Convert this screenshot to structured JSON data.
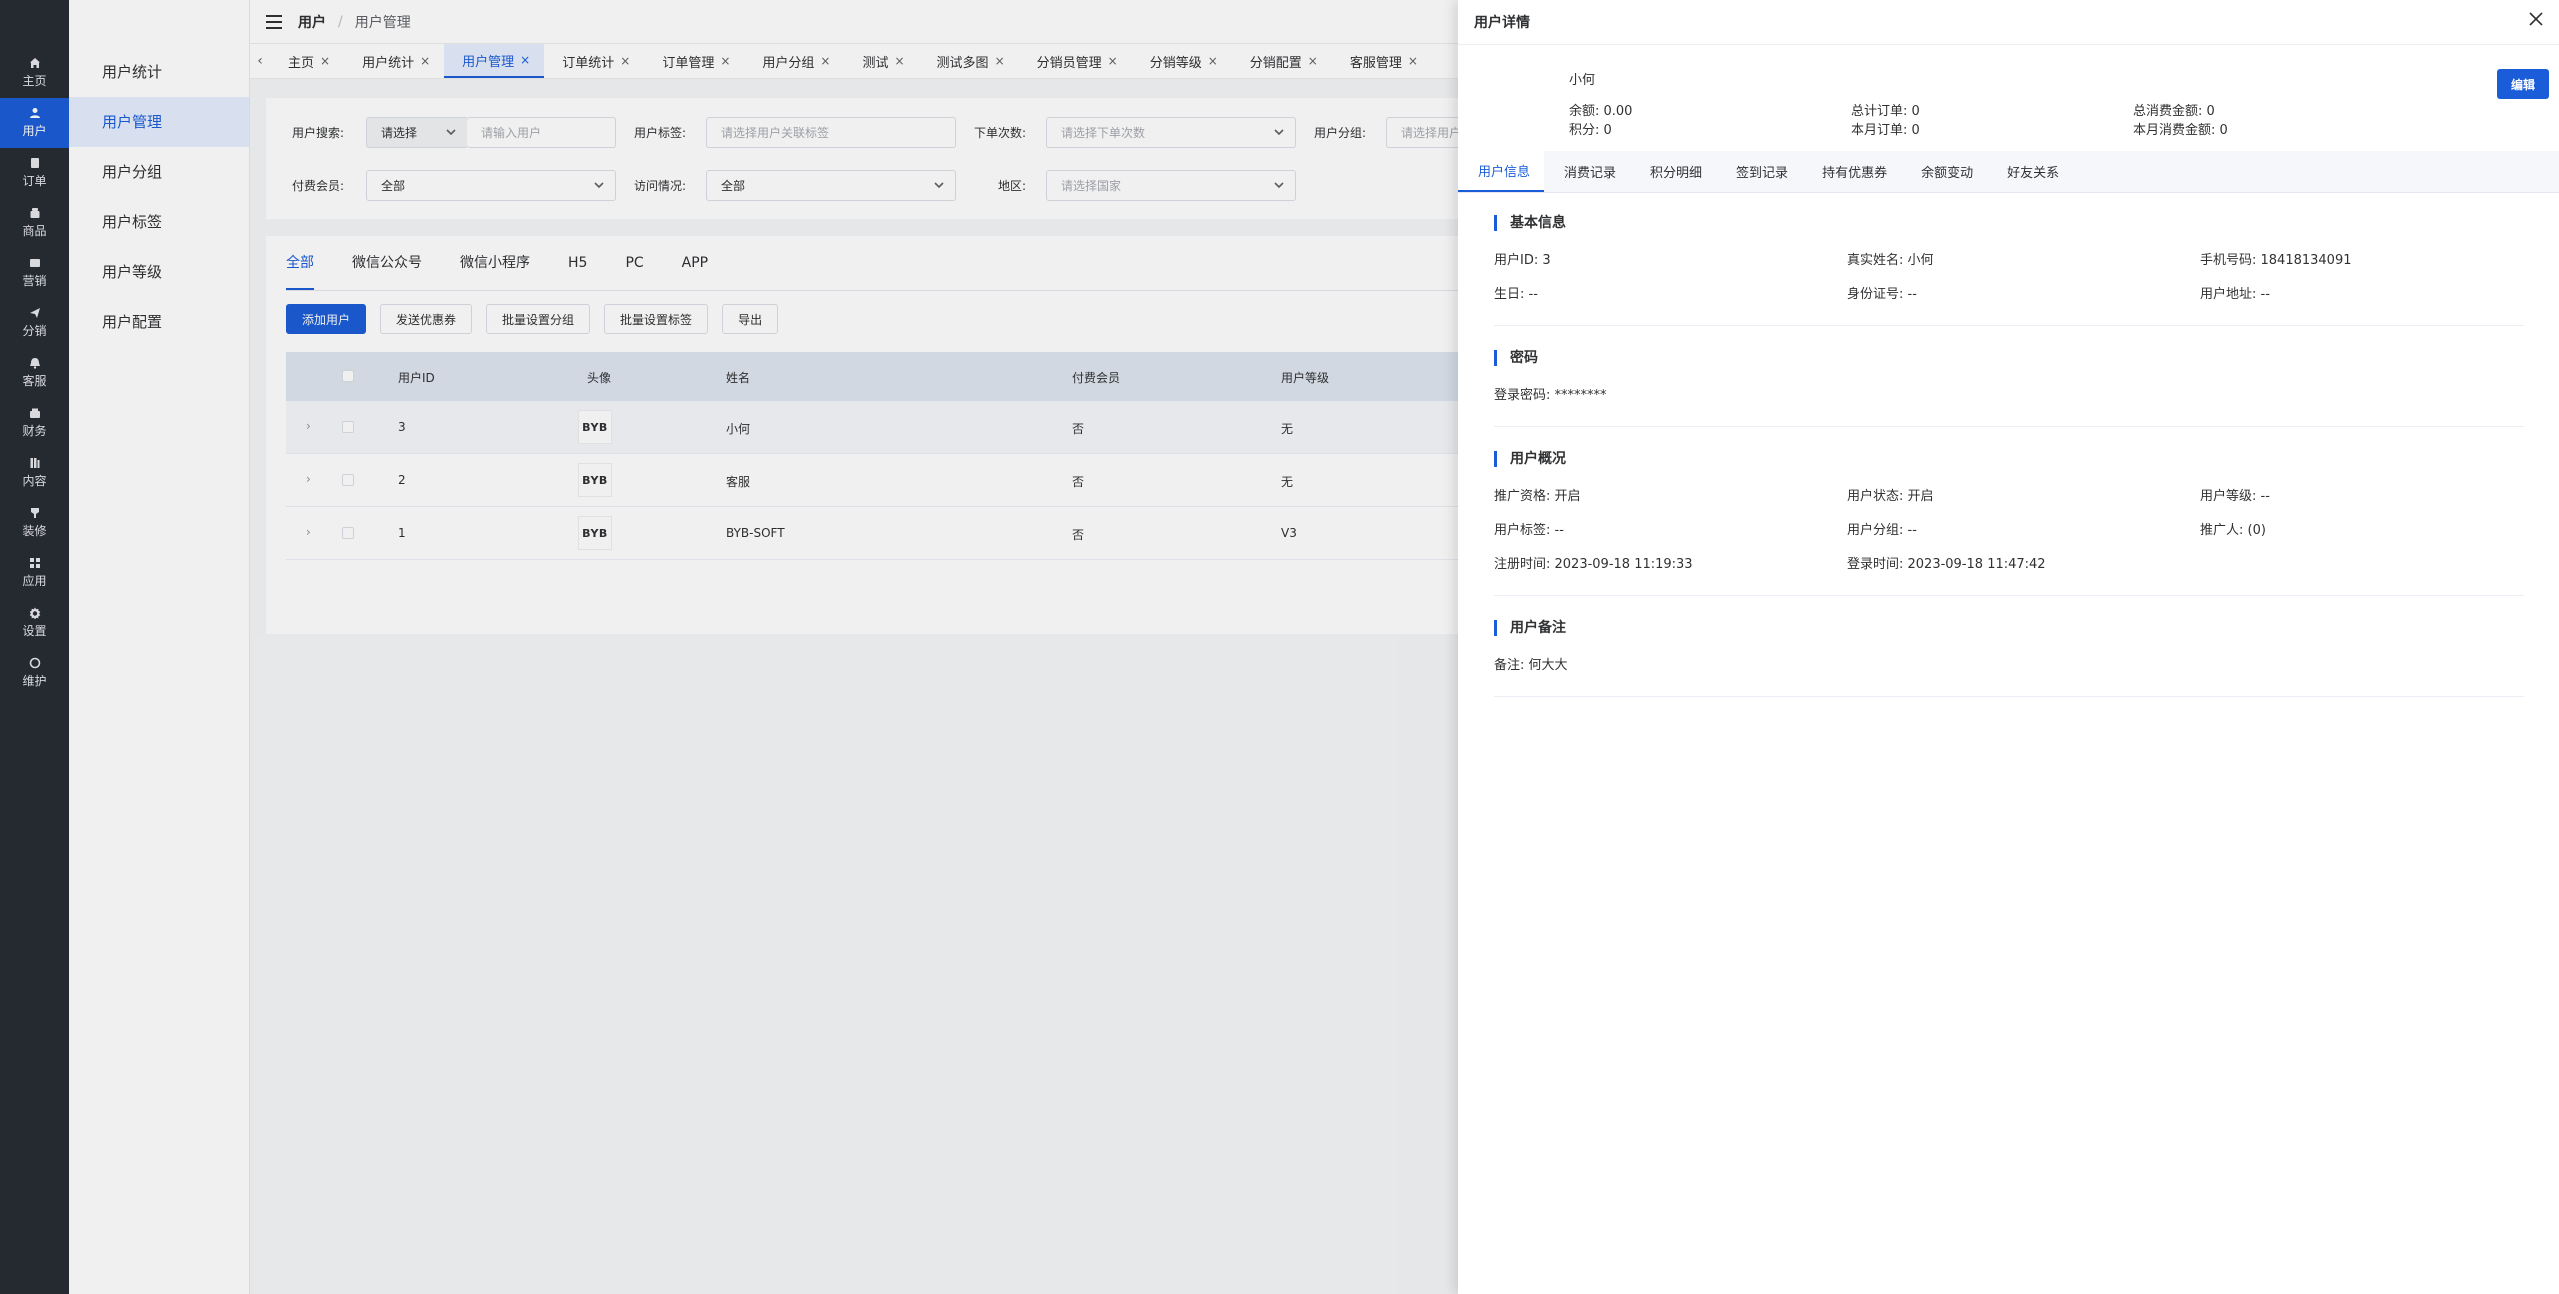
{
  "rail": [
    {
      "icon": "home-icon",
      "label": "主页",
      "active": false
    },
    {
      "icon": "user-icon",
      "label": "用户",
      "active": true
    },
    {
      "icon": "order-icon",
      "label": "订单",
      "active": false
    },
    {
      "icon": "product-icon",
      "label": "商品",
      "active": false
    },
    {
      "icon": "marketing-icon",
      "label": "营销",
      "active": false
    },
    {
      "icon": "distribution-icon",
      "label": "分销",
      "active": false
    },
    {
      "icon": "service-icon",
      "label": "客服",
      "active": false
    },
    {
      "icon": "finance-icon",
      "label": "财务",
      "active": false
    },
    {
      "icon": "content-icon",
      "label": "内容",
      "active": false
    },
    {
      "icon": "decoration-icon",
      "label": "装修",
      "active": false
    },
    {
      "icon": "apps-icon",
      "label": "应用",
      "active": false
    },
    {
      "icon": "gear-icon",
      "label": "设置",
      "active": false
    },
    {
      "icon": "maintenance-icon",
      "label": "维护",
      "active": false
    }
  ],
  "submenu": [
    {
      "label": "用户统计",
      "active": false
    },
    {
      "label": "用户管理",
      "active": true
    },
    {
      "label": "用户分组",
      "active": false
    },
    {
      "label": "用户标签",
      "active": false
    },
    {
      "label": "用户等级",
      "active": false
    },
    {
      "label": "用户配置",
      "active": false
    }
  ],
  "breadcrumb": {
    "first": "用户",
    "sep": "/",
    "current": "用户管理"
  },
  "tabs": [
    {
      "label": "主页",
      "active": false
    },
    {
      "label": "用户统计",
      "active": false
    },
    {
      "label": "用户管理",
      "active": true
    },
    {
      "label": "订单统计",
      "active": false
    },
    {
      "label": "订单管理",
      "active": false
    },
    {
      "label": "用户分组",
      "active": false
    },
    {
      "label": "测试",
      "active": false
    },
    {
      "label": "测试多图",
      "active": false
    },
    {
      "label": "分销员管理",
      "active": false
    },
    {
      "label": "分销等级",
      "active": false
    },
    {
      "label": "分销配置",
      "active": false
    },
    {
      "label": "客服管理",
      "active": false
    }
  ],
  "tab_close": "×",
  "tab_prev": "‹",
  "filters": {
    "search_label": "用户搜索:",
    "search_select": "请选择",
    "search_placeholder": "请输入用户",
    "tag_label": "用户标签:",
    "tag_placeholder": "请选择用户关联标签",
    "order_label": "下单次数:",
    "order_placeholder": "请选择下单次数",
    "group_label": "用户分组:",
    "group_placeholder": "请选择用户",
    "member_label": "付费会员:",
    "member_value": "全部",
    "visit_label": "访问情况:",
    "visit_value": "全部",
    "region_label": "地区:",
    "region_placeholder": "请选择国家"
  },
  "channel_tabs": [
    {
      "label": "全部",
      "active": true
    },
    {
      "label": "微信公众号",
      "active": false
    },
    {
      "label": "微信小程序",
      "active": false
    },
    {
      "label": "H5",
      "active": false
    },
    {
      "label": "PC",
      "active": false
    },
    {
      "label": "APP",
      "active": false
    }
  ],
  "actions": {
    "add": "添加用户",
    "coupon": "发送优惠券",
    "batch_group": "批量设置分组",
    "batch_tag": "批量设置标签",
    "export": "导出"
  },
  "table": {
    "headers": {
      "id": "用户ID",
      "avatar": "头像",
      "name": "姓名",
      "member": "付费会员",
      "level": "用户等级"
    },
    "rows": [
      {
        "id": "3",
        "avatar": "BYB",
        "name": "小何",
        "member": "否",
        "level": "无"
      },
      {
        "id": "2",
        "avatar": "BYB",
        "name": "客服",
        "member": "否",
        "level": "无"
      },
      {
        "id": "1",
        "avatar": "BYB",
        "name": "BYB-SOFT",
        "member": "否",
        "level": "V3"
      }
    ],
    "expand_glyph": "›"
  },
  "drawer": {
    "title": "用户详情",
    "name": "小何",
    "balance": "余额: 0.00",
    "points": "积分: 0",
    "total_orders": "总计订单: 0",
    "month_orders": "本月订单: 0",
    "total_spend": "总消费金额: 0",
    "month_spend": "本月消费金额: 0",
    "edit": "编辑",
    "tabs": [
      {
        "label": "用户信息",
        "active": true
      },
      {
        "label": "消费记录",
        "active": false
      },
      {
        "label": "积分明细",
        "active": false
      },
      {
        "label": "签到记录",
        "active": false
      },
      {
        "label": "持有优惠券",
        "active": false
      },
      {
        "label": "余额变动",
        "active": false
      },
      {
        "label": "好友关系",
        "active": false
      }
    ],
    "basic": {
      "title": "基本信息",
      "user_id": "用户ID: 3",
      "real_name": "真实姓名: 小何",
      "phone": "手机号码: 18418134091",
      "birthday": "生日: --",
      "id_card": "身份证号: --",
      "address": "用户地址: --"
    },
    "password": {
      "title": "密码",
      "login_pwd": "登录密码: ********"
    },
    "overview": {
      "title": "用户概况",
      "promo": "推广资格: 开启",
      "status": "用户状态: 开启",
      "level": "用户等级: --",
      "tags": "用户标签: --",
      "group": "用户分组: --",
      "promoter": "推广人: (0)",
      "reg_time": "注册时间: 2023-09-18 11:19:33",
      "login_time": "登录时间: 2023-09-18 11:47:42"
    },
    "remark": {
      "title": "用户备注",
      "text": "备注: 何大大"
    }
  },
  "colors": {
    "accent": "#1b5dd8",
    "rail_bg": "#282c34"
  }
}
